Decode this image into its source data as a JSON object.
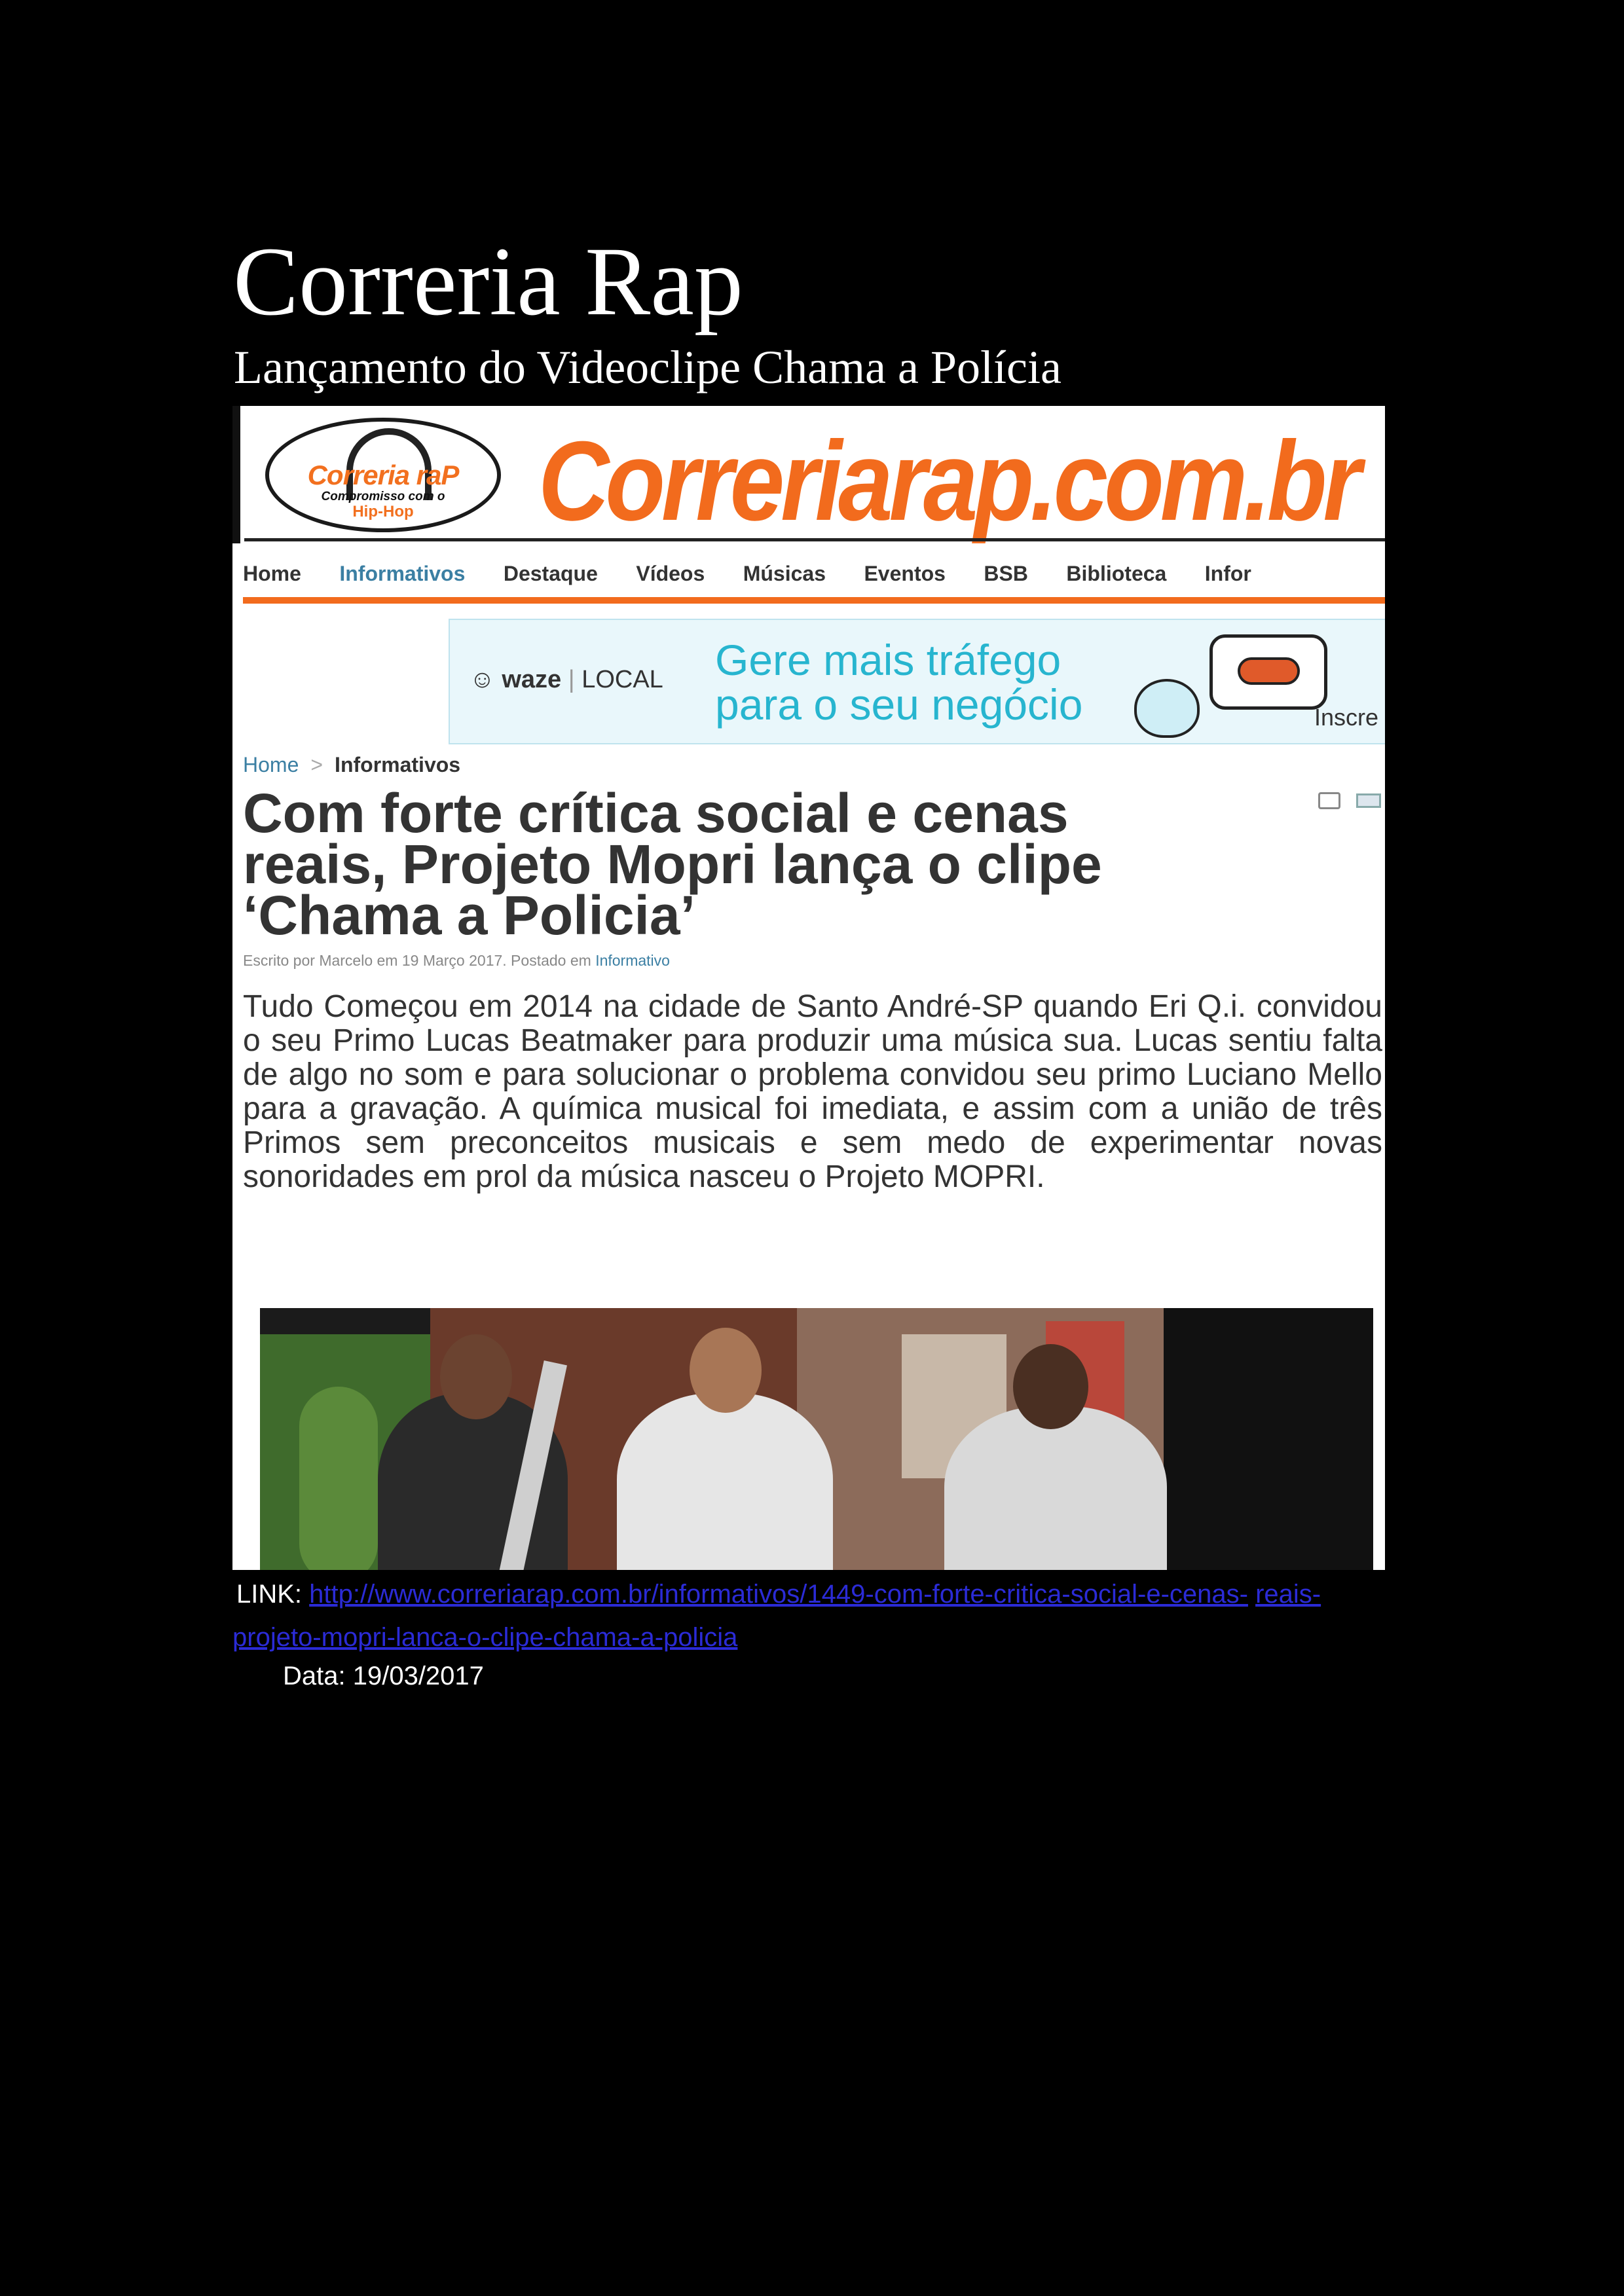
{
  "document": {
    "title": "Correria Rap",
    "subtitle": "Lançamento do Videoclipe Chama a Polícia"
  },
  "site": {
    "logo": {
      "name": "Correria raP",
      "tagline": "Compromisso com o",
      "tagline2": "Hip-Hop"
    },
    "wordmark": "Correriarap.com.br",
    "nav": [
      "Home",
      "Informativos",
      "Destaque",
      "Vídeos",
      "Músicas",
      "Eventos",
      "BSB",
      "Biblioteca",
      "Infor"
    ],
    "nav_active": "Informativos"
  },
  "ad": {
    "brand": "waze",
    "brand_suffix": "LOCAL",
    "line1": "Gere mais tráfego",
    "line2": "para o seu negócio",
    "cta": "Inscre"
  },
  "breadcrumb": {
    "home": "Home",
    "separator": ">",
    "current": "Informativos"
  },
  "article": {
    "title": "Com forte crítica social e cenas reais, Projeto Mopri lança o clipe ‘Chama a Policia’",
    "meta_prefix": "Escrito por Marcelo em 19 Março 2017. Postado em ",
    "meta_category": "Informativo",
    "body": "Tudo Começou em 2014 na cidade de Santo André-SP quando Eri Q.i.  convidou o seu Primo Lucas Beatmaker para produzir uma música sua. Lucas sentiu falta de algo no som e para solucionar o problema convidou seu primo Luciano Mello para  a gravação. A química musical  foi imediata, e assim com a união de três Primos sem preconceitos musicais e sem medo  de experimentar novas sonoridades em prol da música  nasceu o Projeto MOPRI."
  },
  "source": {
    "link_label": "LINK:",
    "link_part1": "http://www.correriarap.com.br/informativos/1449-com-forte-critica-social-e-cenas-",
    "link_part2": "reais-projeto-mopri-lanca-o-clipe-chama-a-policia",
    "date": "Data: 19/03/2017"
  },
  "colors": {
    "background": "#000000",
    "brand_orange": "#f26b1d",
    "link_blue": "#2b2bd6",
    "nav_active": "#3b7fa3"
  }
}
